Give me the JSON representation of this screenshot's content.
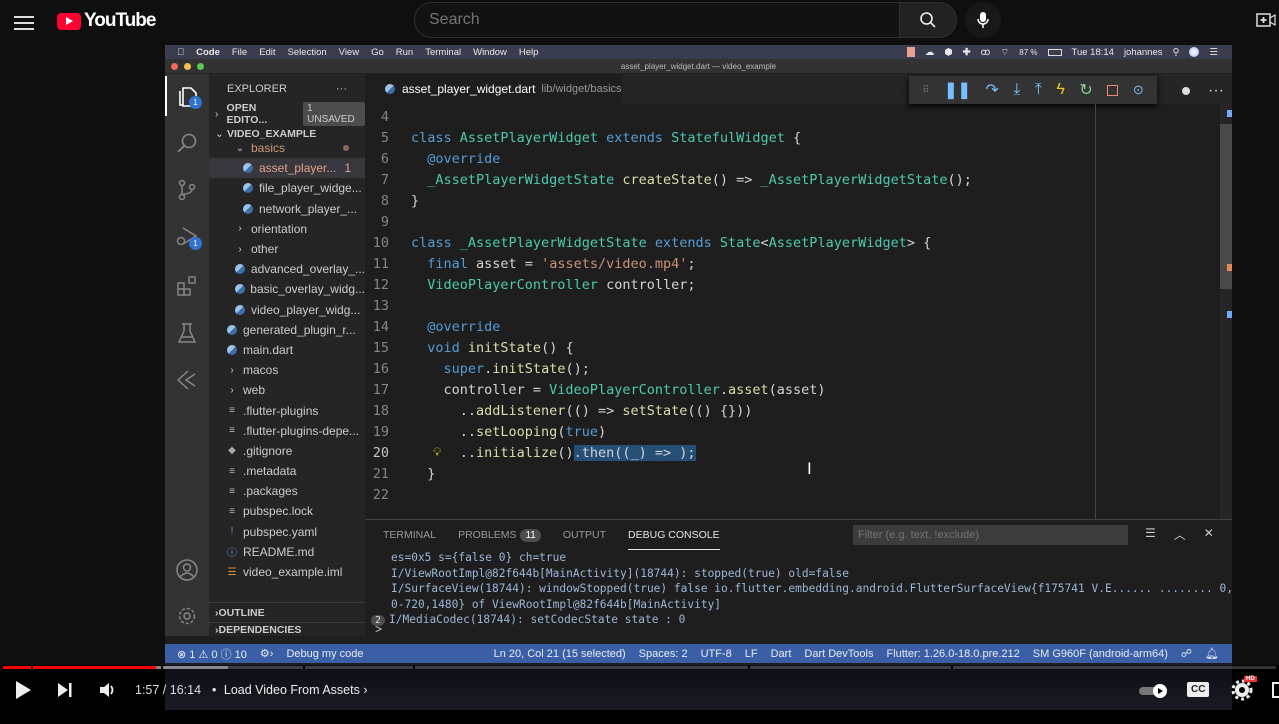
{
  "youtube": {
    "logo_text": "YouTube",
    "search_placeholder": "Search",
    "player": {
      "current_time": "1:57",
      "duration": "16:14",
      "time_display": "1:57 / 16:14",
      "chapter_separator": "•",
      "chapter_title": "Load Video From Assets",
      "progress_fraction": 0.12,
      "buffered_fraction": 0.177,
      "hd_badge": "HD",
      "cc_label": "CC"
    }
  },
  "mac_menubar": {
    "app": "Code",
    "items": [
      "File",
      "Edit",
      "Selection",
      "View",
      "Go",
      "Run",
      "Terminal",
      "Window",
      "Help"
    ],
    "battery": "87 %",
    "clock": "Tue 18:14",
    "user": "johannes"
  },
  "window_title": "asset_player_widget.dart — video_example",
  "activity_bar": {
    "explorer_badge": "1",
    "debug_badge": "1"
  },
  "sidebar": {
    "title": "EXPLORER",
    "more": "···",
    "open_editors": "OPEN EDITO...",
    "unsaved_badge": "1 UNSAVED",
    "project": "VIDEO_EXAMPLE",
    "tree": [
      {
        "label": "basics",
        "type": "folder-open",
        "indent": 2,
        "modified": true
      },
      {
        "label": "asset_player...",
        "type": "dart",
        "indent": 3,
        "selected": true,
        "problems": "1"
      },
      {
        "label": "file_player_widge...",
        "type": "dart",
        "indent": 3
      },
      {
        "label": "network_player_...",
        "type": "dart",
        "indent": 3
      },
      {
        "label": "orientation",
        "type": "folder",
        "indent": 2
      },
      {
        "label": "other",
        "type": "folder",
        "indent": 2
      },
      {
        "label": "advanced_overlay_...",
        "type": "dart",
        "indent": 2
      },
      {
        "label": "basic_overlay_widg...",
        "type": "dart",
        "indent": 2
      },
      {
        "label": "video_player_widg...",
        "type": "dart",
        "indent": 2
      },
      {
        "label": "generated_plugin_r...",
        "type": "dart",
        "indent": 1
      },
      {
        "label": "main.dart",
        "type": "dart",
        "indent": 1
      },
      {
        "label": "macos",
        "type": "folder",
        "indent": 1
      },
      {
        "label": "web",
        "type": "folder",
        "indent": 1
      },
      {
        "label": ".flutter-plugins",
        "type": "text",
        "indent": 1
      },
      {
        "label": ".flutter-plugins-depe...",
        "type": "text",
        "indent": 1
      },
      {
        "label": ".gitignore",
        "type": "git",
        "indent": 1
      },
      {
        "label": ".metadata",
        "type": "text",
        "indent": 1
      },
      {
        "label": ".packages",
        "type": "text",
        "indent": 1
      },
      {
        "label": "pubspec.lock",
        "type": "text",
        "indent": 1
      },
      {
        "label": "pubspec.yaml",
        "type": "yaml",
        "indent": 1
      },
      {
        "label": "README.md",
        "type": "info",
        "indent": 1
      },
      {
        "label": "video_example.iml",
        "type": "rss",
        "indent": 1
      }
    ],
    "outline": "OUTLINE",
    "dependencies": "DEPENDENCIES"
  },
  "editor": {
    "tab_file": "asset_player_widget.dart",
    "tab_path": "lib/widget/basics",
    "current_line": 20,
    "lines": [
      {
        "n": "4",
        "tokens": []
      },
      {
        "n": "5",
        "tokens": [
          [
            "kw",
            "class "
          ],
          [
            "ty",
            "AssetPlayerWidget "
          ],
          [
            "kw",
            "extends "
          ],
          [
            "ty",
            "StatefulWidget "
          ],
          [
            "pl",
            "{"
          ]
        ]
      },
      {
        "n": "6",
        "tokens": [
          [
            "pl",
            "  "
          ],
          [
            "an",
            "@override"
          ]
        ]
      },
      {
        "n": "7",
        "tokens": [
          [
            "pl",
            "  "
          ],
          [
            "ty",
            "_AssetPlayerWidgetState "
          ],
          [
            "fn",
            "createState"
          ],
          [
            "pl",
            "() => "
          ],
          [
            "ty",
            "_AssetPlayerWidgetState"
          ],
          [
            "pl",
            "();"
          ]
        ]
      },
      {
        "n": "8",
        "tokens": [
          [
            "pl",
            "}"
          ]
        ]
      },
      {
        "n": "9",
        "tokens": []
      },
      {
        "n": "10",
        "tokens": [
          [
            "kw",
            "class "
          ],
          [
            "ty",
            "_AssetPlayerWidgetState "
          ],
          [
            "kw",
            "extends "
          ],
          [
            "ty",
            "State"
          ],
          [
            "pl",
            "<"
          ],
          [
            "ty",
            "AssetPlayerWidget"
          ],
          [
            "pl",
            "> {"
          ]
        ]
      },
      {
        "n": "11",
        "tokens": [
          [
            "pl",
            "  "
          ],
          [
            "kw",
            "final "
          ],
          [
            "pl",
            "asset = "
          ],
          [
            "st",
            "'assets/video.mp4'"
          ],
          [
            "pl",
            ";"
          ]
        ]
      },
      {
        "n": "12",
        "tokens": [
          [
            "pl",
            "  "
          ],
          [
            "ty",
            "VideoPlayerController "
          ],
          [
            "pl",
            "controller;"
          ]
        ]
      },
      {
        "n": "13",
        "tokens": []
      },
      {
        "n": "14",
        "tokens": [
          [
            "pl",
            "  "
          ],
          [
            "an",
            "@override"
          ]
        ]
      },
      {
        "n": "15",
        "tokens": [
          [
            "pl",
            "  "
          ],
          [
            "kw",
            "void "
          ],
          [
            "fn",
            "initState"
          ],
          [
            "pl",
            "() {"
          ]
        ]
      },
      {
        "n": "16",
        "tokens": [
          [
            "pl",
            "    "
          ],
          [
            "kw",
            "super"
          ],
          [
            "pl",
            "."
          ],
          [
            "fn",
            "initState"
          ],
          [
            "pl",
            "();"
          ]
        ]
      },
      {
        "n": "17",
        "tokens": [
          [
            "pl",
            "    controller = "
          ],
          [
            "ty",
            "VideoPlayerController"
          ],
          [
            "pl",
            "."
          ],
          [
            "fn",
            "asset"
          ],
          [
            "pl",
            "(asset)"
          ]
        ]
      },
      {
        "n": "18",
        "tokens": [
          [
            "pl",
            "      .."
          ],
          [
            "fn",
            "addListener"
          ],
          [
            "pl",
            "(() => "
          ],
          [
            "fn",
            "setState"
          ],
          [
            "pl",
            "(() {}))"
          ]
        ]
      },
      {
        "n": "19",
        "tokens": [
          [
            "pl",
            "      .."
          ],
          [
            "fn",
            "setLooping"
          ],
          [
            "pl",
            "("
          ],
          [
            "kw",
            "true"
          ],
          [
            "pl",
            ")"
          ]
        ]
      },
      {
        "n": "20",
        "tokens": [
          [
            "pl",
            "      .."
          ],
          [
            "fn",
            "initialize"
          ],
          [
            "pl",
            "()"
          ],
          [
            "sel",
            ".then((_) => );"
          ]
        ]
      },
      {
        "n": "21",
        "tokens": [
          [
            "pl",
            "  }"
          ]
        ]
      },
      {
        "n": "22",
        "tokens": []
      }
    ]
  },
  "panel": {
    "tabs": [
      "TERMINAL",
      "PROBLEMS",
      "OUTPUT",
      "DEBUG CONSOLE"
    ],
    "active_tab": "DEBUG CONSOLE",
    "problems_count": "11",
    "filter_placeholder": "Filter (e.g. text, !exclude)",
    "console_lines": [
      "es=0x5 s={false 0} ch=true",
      "I/ViewRootImpl@82f644b[MainActivity](18744): stopped(true) old=false",
      "I/SurfaceView(18744): windowStopped(true) false io.flutter.embedding.android.FlutterSurfaceView{f175741 V.E...... ........ 0,",
      "0-720,1480} of ViewRootImpl@82f644b[MainActivity]"
    ],
    "repeat_line": {
      "count": "2",
      "text": "I/MediaCodec(18744): setCodecState state : 0"
    },
    "prompt": ">"
  },
  "statusbar": {
    "errors": "1",
    "warnings": "0",
    "infos": "10",
    "debug_label": "Debug my code",
    "cursor": "Ln 20, Col 21 (15 selected)",
    "spaces": "Spaces: 2",
    "encoding": "UTF-8",
    "eol": "LF",
    "language": "Dart",
    "devtools": "Dart DevTools",
    "flutter": "Flutter: 1.26.0-18.0.pre.212",
    "device": "SM G960F (android-arm64)"
  },
  "colors": {
    "youtube_red": "#ff0000",
    "status_bar": "#3a5fa5",
    "selection": "#264f78",
    "badge_blue": "#2f74d0"
  }
}
